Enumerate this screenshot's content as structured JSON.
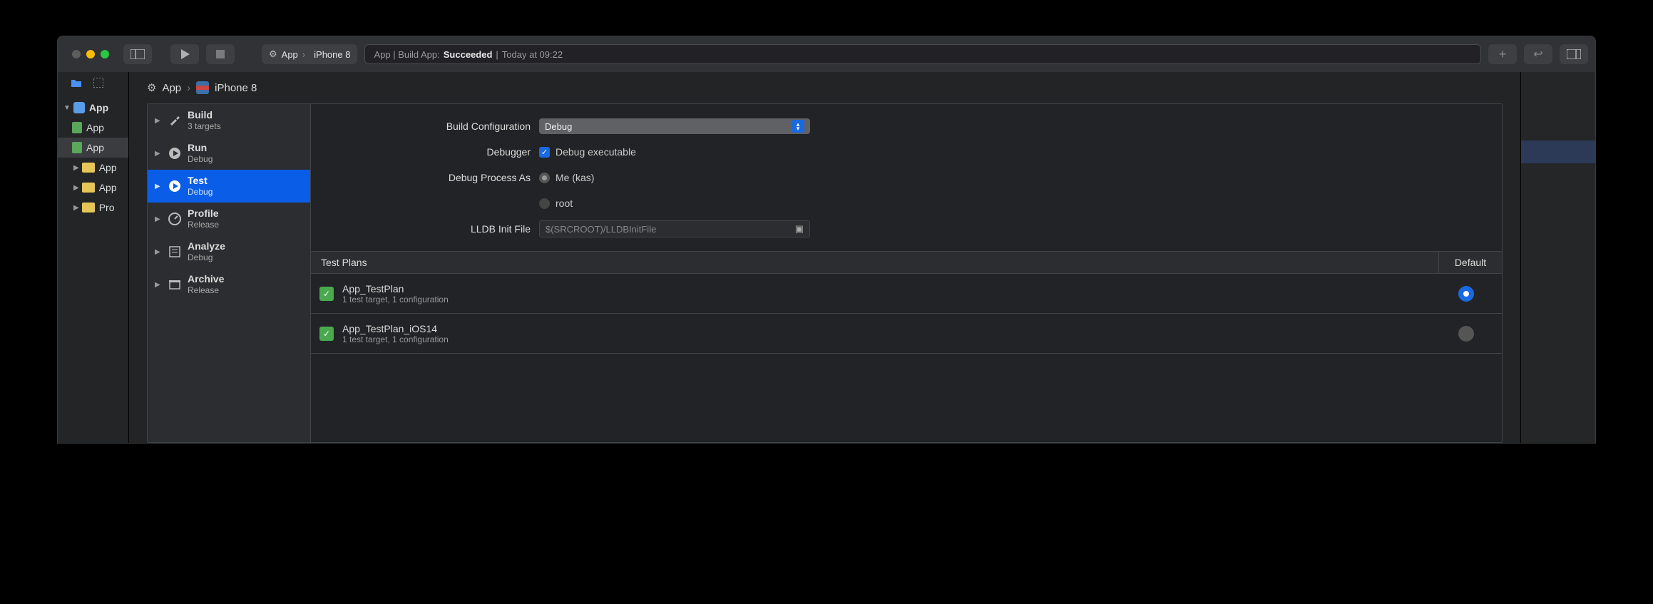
{
  "toolbar": {
    "scheme_app": "App",
    "scheme_device": "iPhone 8",
    "activity_prefix": "App | Build App:",
    "activity_status": "Succeeded",
    "activity_sep": "|",
    "activity_time": "Today at 09:22"
  },
  "navigator": {
    "root": "App",
    "items": [
      "App",
      "App",
      "App",
      "App",
      "Pro"
    ]
  },
  "crumb": {
    "target": "App",
    "device": "iPhone 8"
  },
  "scheme_sidebar": [
    {
      "title": "Build",
      "subtitle": "3 targets"
    },
    {
      "title": "Run",
      "subtitle": "Debug"
    },
    {
      "title": "Test",
      "subtitle": "Debug"
    },
    {
      "title": "Profile",
      "subtitle": "Release"
    },
    {
      "title": "Analyze",
      "subtitle": "Debug"
    },
    {
      "title": "Archive",
      "subtitle": "Release"
    }
  ],
  "form": {
    "build_config_label": "Build Configuration",
    "build_config_value": "Debug",
    "debugger_label": "Debugger",
    "debugger_checkbox": "Debug executable",
    "debug_as_label": "Debug Process As",
    "debug_as_me": "Me (kas)",
    "debug_as_root": "root",
    "lldb_label": "LLDB Init File",
    "lldb_placeholder": "$(SRCROOT)/LLDBInitFile"
  },
  "table": {
    "col1": "Test Plans",
    "col2": "Default",
    "plans": [
      {
        "name": "App_TestPlan",
        "sub": "1 test target, 1 configuration",
        "default": true
      },
      {
        "name": "App_TestPlan_iOS14",
        "sub": "1 test target, 1 configuration",
        "default": false
      }
    ]
  }
}
